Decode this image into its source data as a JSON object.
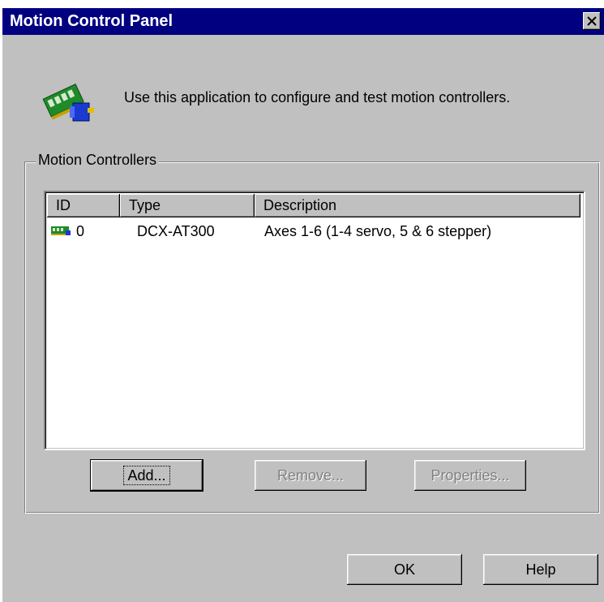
{
  "window": {
    "title": "Motion Control Panel",
    "close_icon": "close-icon"
  },
  "intro": {
    "icon": "motion-controller-app-icon",
    "text": "Use this application to configure and test motion controllers."
  },
  "group": {
    "label": "Motion Controllers"
  },
  "list": {
    "columns": [
      "ID",
      "Type",
      "Description"
    ],
    "rows": [
      {
        "icon": "controller-card-icon",
        "id": "0",
        "type": "DCX-AT300",
        "description": "Axes 1-6 (1-4 servo, 5 & 6 stepper)"
      }
    ]
  },
  "buttons": {
    "add": "Add...",
    "remove": "Remove...",
    "properties": "Properties...",
    "ok": "OK",
    "help": "Help"
  },
  "colors": {
    "titlebar": "#000080",
    "face": "#c0c0c0",
    "disabled_text": "#808080"
  }
}
